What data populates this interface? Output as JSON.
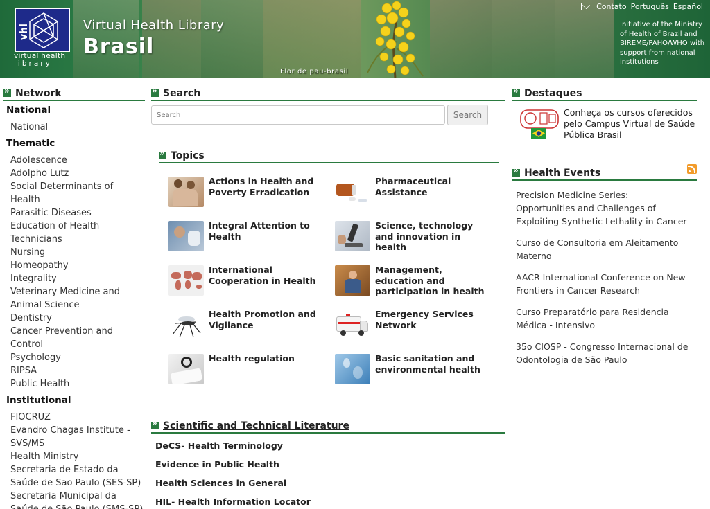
{
  "header": {
    "logo_text": "vhl",
    "logo_caption_line1": "virtual health",
    "logo_caption_line2": "library",
    "title": "Virtual Health Library",
    "subtitle": "Brasil",
    "flower_caption": "Flor de pau-brasil",
    "links": [
      "Contato",
      "Português",
      "Español"
    ],
    "mail_icon": "envelope-icon",
    "initiative": "Initiative of the Ministry of Health of Brazil and BIREME/PAHO/WHO with support from national institutions"
  },
  "network": {
    "heading": "Network",
    "groups": [
      {
        "title": "National",
        "items": [
          "National"
        ]
      },
      {
        "title": "Thematic",
        "items": [
          "Adolescence",
          "Adolpho Lutz",
          "Social Determinants of Health",
          "Parasitic Diseases",
          "Education of Health Technicians",
          "Nursing",
          "Homeopathy",
          "Integrality",
          "Veterinary Medicine and Animal Science",
          "Dentistry",
          "Cancer Prevention and Control",
          "Psychology",
          "RIPSA",
          "Public Health"
        ]
      },
      {
        "title": "Institutional",
        "items": [
          "FIOCRUZ",
          "Evandro Chagas Institute - SVS/MS",
          "Health Ministry",
          "Secretaria de Estado da Saúde de Sao Paulo (SES-SP)",
          "Secretaria Municipal da Saúde de São Paulo (SMS-SP)"
        ]
      }
    ]
  },
  "search": {
    "heading": "Search",
    "placeholder": "Search",
    "button": "Search"
  },
  "topics": {
    "heading": "Topics",
    "items": [
      {
        "label": "Actions in Health and Poverty Erradication"
      },
      {
        "label": "Pharmaceutical Assistance"
      },
      {
        "label": "Integral Attention to Health"
      },
      {
        "label": "Science, technology and innovation in health"
      },
      {
        "label": "International Cooperation in Health"
      },
      {
        "label": "Management, education and participation in health"
      },
      {
        "label": "Health Promotion and Vigilance"
      },
      {
        "label": "Emergency Services Network"
      },
      {
        "label": "Health regulation"
      },
      {
        "label": "Basic sanitation and environmental health"
      }
    ]
  },
  "literature": {
    "heading": "Scientific and Technical Literature",
    "items": [
      "DeCS- Health Terminology",
      "Evidence in Public Health",
      "Health Sciences in General",
      "HIL- Health Information Locator"
    ]
  },
  "destaques": {
    "heading": "Destaques",
    "banner": "Conheça os cursos oferecidos pelo Campus Virtual de Saúde Pública Brasil"
  },
  "events": {
    "heading": "Health Events",
    "items": [
      "Precision Medicine Series: Opportunities and Challenges of Exploiting Synthetic Lethality in Cancer",
      "Curso de Consultoria em Aleitamento Materno",
      "AACR International Conference on New Frontiers in Cancer Research",
      "Curso Preparatório para Residencia Médica - Intensivo",
      "35o CIOSP - Congresso Internacional de Odontologia de São Paulo"
    ]
  },
  "colors": {
    "accent_green": "#2a7a3f",
    "logo_blue": "#1e2a8a",
    "rss_orange": "#f29b2a"
  }
}
